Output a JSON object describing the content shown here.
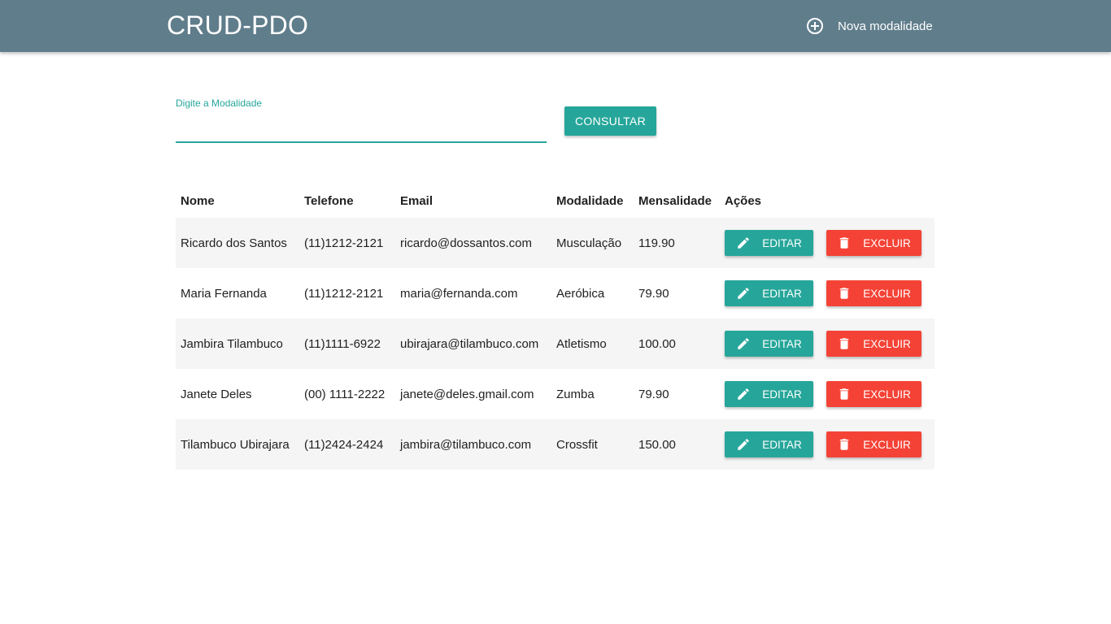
{
  "header": {
    "brand": "CRUD-PDO",
    "new_item_label": "Nova modalidade",
    "new_item_icon": "add-circle-outline-icon"
  },
  "search": {
    "label": "Digite a Modalidade",
    "value": "",
    "button_label": "CONSULTAR"
  },
  "table": {
    "headers": [
      "Nome",
      "Telefone",
      "Email",
      "Modalidade",
      "Mensalidade",
      "Ações"
    ],
    "rows": [
      {
        "nome": "Ricardo dos Santos",
        "telefone": "(11)1212-2121",
        "email": "ricardo@dossantos.com",
        "modalidade": "Musculação",
        "mensalidade": "119.90"
      },
      {
        "nome": "Maria Fernanda",
        "telefone": "(11)1212-2121",
        "email": "maria@fernanda.com",
        "modalidade": "Aeróbica",
        "mensalidade": "79.90"
      },
      {
        "nome": "Jambira Tilambuco",
        "telefone": "(11)1111-6922",
        "email": "ubirajara@tilambuco.com",
        "modalidade": "Atletismo",
        "mensalidade": "100.00"
      },
      {
        "nome": "Janete Deles",
        "telefone": "(00) 1111-2222",
        "email": "janete@deles.gmail.com",
        "modalidade": "Zumba",
        "mensalidade": "79.90"
      },
      {
        "nome": "Tilambuco Ubirajara",
        "telefone": "(11)2424-2424",
        "email": "jambira@tilambuco.com",
        "modalidade": "Crossfit",
        "mensalidade": "150.00"
      }
    ],
    "edit_label": "EDITAR",
    "edit_icon": "pencil-icon",
    "delete_label": "EXCLUIR",
    "delete_icon": "trash-icon"
  },
  "colors": {
    "navbar": "#607d8b",
    "primary": "#26a69a",
    "danger": "#f44336",
    "row_stripe": "#f5f5f5"
  }
}
